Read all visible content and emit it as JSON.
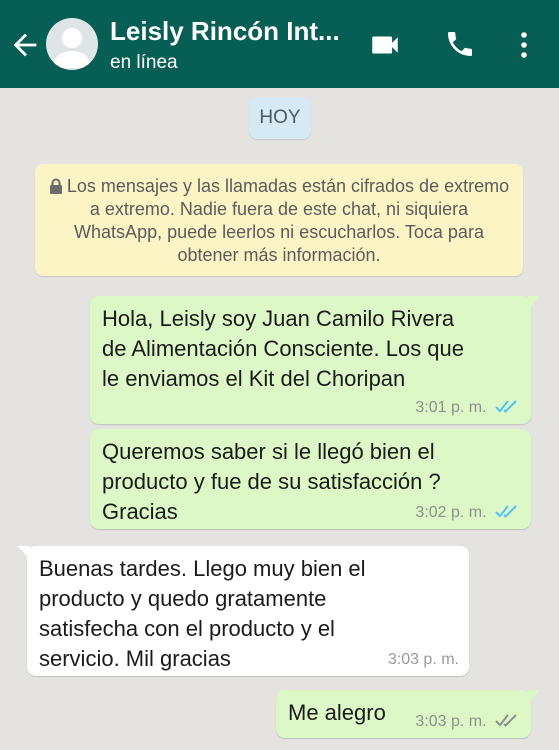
{
  "header": {
    "contact_name": "Leisly Rincón Int...",
    "status": "en línea",
    "icons": [
      "back-arrow-icon",
      "avatar-placeholder",
      "video-call-icon",
      "phone-call-icon",
      "more-vert-icon"
    ],
    "color": "#075e54"
  },
  "chat": {
    "date_label": "HOY",
    "encryption_notice": "Los mensajes y las llamadas están cifrados de extremo a extremo. Nadie fuera de este chat, ni siquiera WhatsApp, puede leerlos ni escucharlos. Toca para obtener más información.",
    "messages": [
      {
        "direction": "outgoing",
        "text": "Hola, Leisly soy Juan Camilo Rivera\nde Alimentación Consciente. Los que\nle enviamos el Kit del Choripan",
        "time": "3:01 p. m.",
        "status": "read"
      },
      {
        "direction": "outgoing",
        "text": "Queremos saber si le llegó bien el\nproducto y fue de su satisfacción ?\nGracias",
        "time": "3:02 p. m.",
        "status": "read"
      },
      {
        "direction": "incoming",
        "text": "Buenas tardes. Llego muy bien el\nproducto y quedo gratamente\nsatisfecha con el producto y el\nservicio. Mil gracias",
        "time": "3:03 p. m."
      },
      {
        "direction": "outgoing",
        "text": "Me alegro",
        "time": "3:03 p. m.",
        "status": "delivered"
      }
    ]
  },
  "colors": {
    "outgoing_bubble": "#dcf8c6",
    "incoming_bubble": "#ffffff",
    "background": "#e5e3df",
    "read_ticks": "#4fc3f7",
    "delivered_ticks": "#8a9389"
  }
}
